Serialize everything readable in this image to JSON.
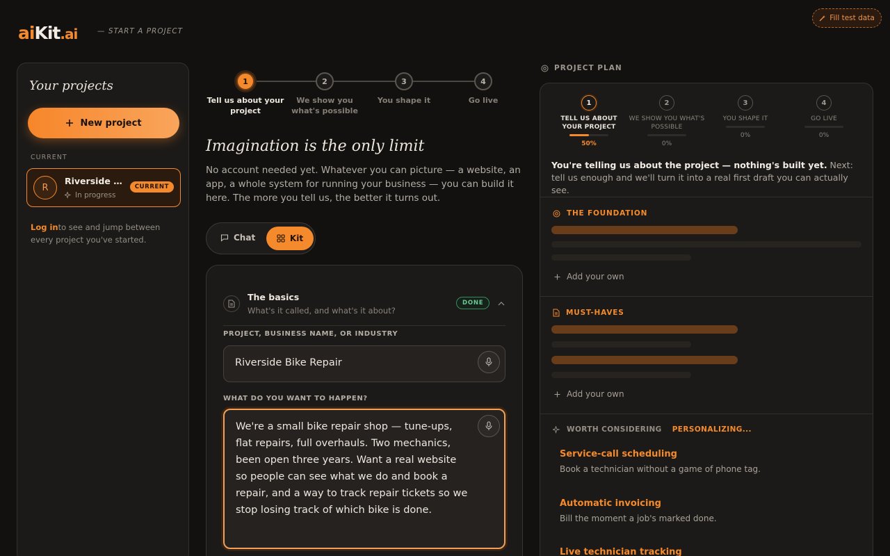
{
  "brand": {
    "logo_ai": "ai",
    "logo_kit": "Kit",
    "logo_dot": ".ai",
    "tagline": "— START A PROJECT"
  },
  "fill_button": "Fill test data",
  "sidebar": {
    "title": "Your projects",
    "new_project": "New project",
    "current_label": "CURRENT",
    "project": {
      "initial": "R",
      "name": "Riverside Bike Repair",
      "status": "In progress",
      "badge": "CURRENT"
    },
    "login_link": "Log in",
    "login_text": "to see and jump between every project you've started."
  },
  "stepper": [
    {
      "num": "1",
      "label": "Tell us about your project",
      "active": true
    },
    {
      "num": "2",
      "label": "We show you what's possible",
      "active": false
    },
    {
      "num": "3",
      "label": "You shape it",
      "active": false
    },
    {
      "num": "4",
      "label": "Go live",
      "active": false
    }
  ],
  "main": {
    "headline": "Imagination is the only limit",
    "intro": "No account needed yet. Whatever you can picture — a website, an app, a whole system for running your business — you can build it here. The more you tell us, the better it turns out.",
    "toggle": {
      "chat": "Chat",
      "kit": "Kit",
      "selected": "Kit"
    }
  },
  "form": {
    "section_title": "The basics",
    "section_sub": "What's it called, and what's it about?",
    "section_badge": "DONE",
    "field1_label": "PROJECT, BUSINESS NAME, OR INDUSTRY",
    "field1_value": "Riverside Bike Repair",
    "field2_label": "WHAT DO YOU WANT TO HAPPEN?",
    "field2_value": "We're a small bike repair shop — tune-ups, flat repairs, full overhauls. Two mechanics, been open three years. Want a real website so people can see what we do and book a repair, and a way to track repair tickets so we stop losing track of which bike is done."
  },
  "plan": {
    "header": "PROJECT PLAN",
    "steps": [
      {
        "num": "1",
        "label": "TELL US ABOUT YOUR PROJECT",
        "progress": "50%",
        "active": true
      },
      {
        "num": "2",
        "label": "WE SHOW YOU WHAT'S POSSIBLE",
        "progress": "0%",
        "active": false
      },
      {
        "num": "3",
        "label": "YOU SHAPE IT",
        "progress": "0%",
        "active": false
      },
      {
        "num": "4",
        "label": "GO LIVE",
        "progress": "0%",
        "active": false
      }
    ],
    "status_bold": "You're telling us about the project — nothing's built yet.",
    "status_rest": " Next: tell us enough and we'll turn it into a real first draft you can actually see.",
    "foundation": "THE FOUNDATION",
    "musthaves": "MUST-HAVES",
    "add_own": "Add your own",
    "worth": "WORTH CONSIDERING",
    "personalizing": "PERSONALIZING...",
    "suggestions": [
      {
        "title": "Service-call scheduling",
        "desc": "Book a technician without a game of phone tag."
      },
      {
        "title": "Automatic invoicing",
        "desc": "Bill the moment a job's marked done."
      },
      {
        "title": "Live technician tracking",
        "desc": ""
      }
    ]
  },
  "colors": {
    "accent": "#f58a2c",
    "done": "#6cc995",
    "bg": "#121110"
  }
}
